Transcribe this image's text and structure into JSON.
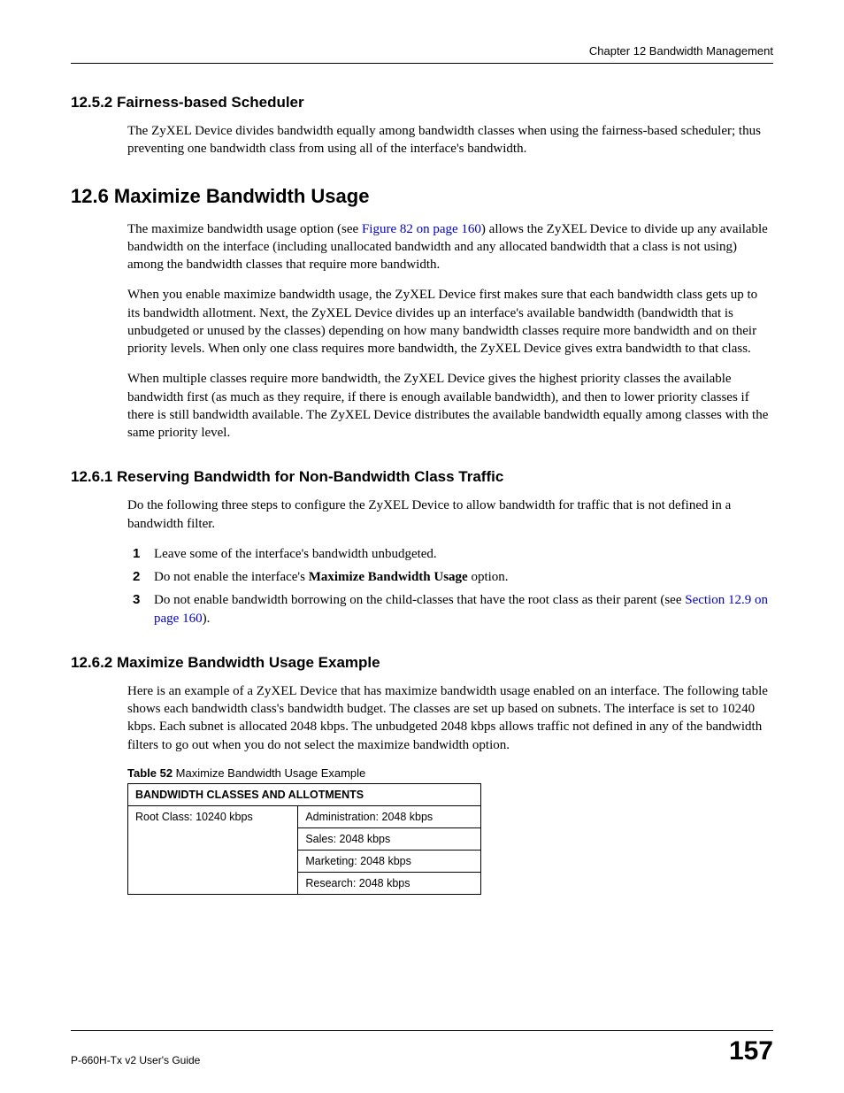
{
  "header": {
    "chapter_label": "Chapter 12 Bandwidth Management"
  },
  "s1252": {
    "heading": "12.5.2  Fairness-based Scheduler",
    "p1": "The ZyXEL Device divides bandwidth equally among bandwidth classes when using the fairness-based scheduler; thus preventing one bandwidth class from using all of the interface's bandwidth."
  },
  "s126": {
    "heading": "12.6  Maximize Bandwidth Usage",
    "p1a": "The maximize bandwidth usage option (see ",
    "p1_link": "Figure 82 on page 160",
    "p1b": ") allows the ZyXEL Device to divide up any available bandwidth on the interface (including unallocated bandwidth and any allocated bandwidth that a class is not using) among the bandwidth classes that require more bandwidth.",
    "p2": "When you enable maximize bandwidth usage, the ZyXEL Device first makes sure that each bandwidth class gets up to its bandwidth allotment. Next, the ZyXEL Device divides up an interface's available bandwidth (bandwidth that is unbudgeted or unused by the classes) depending on how many bandwidth classes require more bandwidth and on their priority levels. When only one class requires more bandwidth, the ZyXEL Device gives extra bandwidth to that class.",
    "p3": "When multiple classes require more bandwidth, the ZyXEL Device gives the highest priority classes the available bandwidth first (as much as they require, if there is enough available bandwidth), and then to lower priority classes if there is still bandwidth available. The ZyXEL Device distributes the available bandwidth equally among classes with the same priority level."
  },
  "s1261": {
    "heading": "12.6.1  Reserving Bandwidth for Non-Bandwidth Class Traffic",
    "p1": "Do the following three steps to configure the ZyXEL Device to allow bandwidth for traffic that is not defined in a bandwidth filter.",
    "step1": "Leave some of the interface's bandwidth unbudgeted.",
    "step2a": "Do not enable the interface's ",
    "step2b": "Maximize Bandwidth Usage",
    "step2c": " option.",
    "step3a": "Do not enable bandwidth borrowing on the child-classes that have the root class as their parent (see ",
    "step3_link": "Section 12.9 on page 160",
    "step3b": ")."
  },
  "s1262": {
    "heading": "12.6.2  Maximize Bandwidth Usage Example",
    "p1": "Here is an example of a ZyXEL Device that has maximize bandwidth usage enabled on an interface. The following table shows each bandwidth class's bandwidth budget. The classes are set up based on subnets. The interface is set to 10240 kbps. Each subnet is allocated 2048 kbps. The unbudgeted 2048 kbps allows traffic not defined in any of the bandwidth filters to go out when you do not select the maximize bandwidth option.",
    "table_caption_bold": "Table 52",
    "table_caption_rest": "   Maximize Bandwidth Usage Example",
    "table_header": "BANDWIDTH CLASSES AND ALLOTMENTS",
    "root_cell": "Root Class: 10240 kbps",
    "row1": "Administration: 2048 kbps",
    "row2": "Sales: 2048 kbps",
    "row3": "Marketing: 2048 kbps",
    "row4": "Research: 2048 kbps"
  },
  "footer": {
    "guide": "P-660H-Tx v2 User's Guide",
    "page": "157"
  },
  "chart_data": {
    "type": "table",
    "title": "Table 52 Maximize Bandwidth Usage Example",
    "header": "BANDWIDTH CLASSES AND ALLOTMENTS",
    "root": {
      "label": "Root Class",
      "kbps": 10240
    },
    "children": [
      {
        "label": "Administration",
        "kbps": 2048
      },
      {
        "label": "Sales",
        "kbps": 2048
      },
      {
        "label": "Marketing",
        "kbps": 2048
      },
      {
        "label": "Research",
        "kbps": 2048
      }
    ]
  }
}
